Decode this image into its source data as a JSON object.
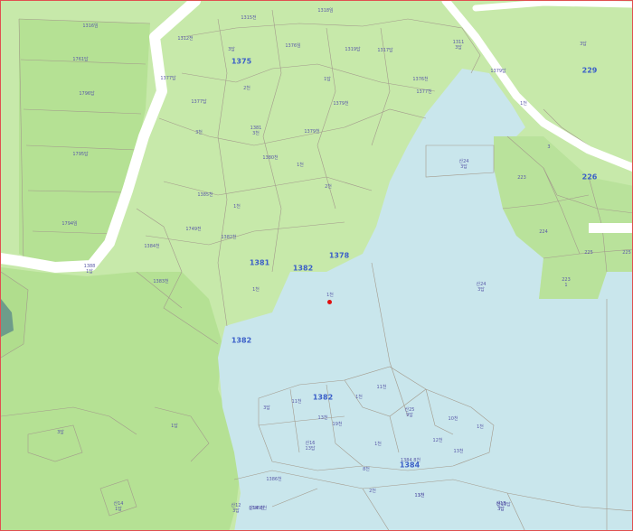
{
  "map": {
    "colors": {
      "forest": "#bfe6a0",
      "forest_light": "#d3efbc",
      "forest_dark": "#a9da84",
      "water": "#c9e6ec",
      "road": "#ffffff",
      "parcel_line": "#a39a8c",
      "block_text": "#3b5fc8",
      "lot_text": "#5a5aa8",
      "marker": "#e01010"
    },
    "block_numbers": [
      {
        "id": "b1375",
        "text": "1375"
      },
      {
        "id": "b229",
        "text": "229"
      },
      {
        "id": "b226",
        "text": "226"
      },
      {
        "id": "b1381",
        "text": "1381"
      },
      {
        "id": "b1382a",
        "text": "1382"
      },
      {
        "id": "b1378",
        "text": "1378"
      },
      {
        "id": "b1382b",
        "text": "1382"
      },
      {
        "id": "b1382c",
        "text": "1382"
      },
      {
        "id": "b1384",
        "text": "1384"
      }
    ],
    "lot_labels": [
      {
        "id": "l01",
        "text": "1316임"
      },
      {
        "id": "l02",
        "text": "1315전"
      },
      {
        "id": "l03",
        "text": "1318임"
      },
      {
        "id": "l04",
        "text": "1312전"
      },
      {
        "id": "l05",
        "text": "3답"
      },
      {
        "id": "l06",
        "text": "1376임"
      },
      {
        "id": "l07",
        "text": "1319답"
      },
      {
        "id": "l08",
        "text": "1317답"
      },
      {
        "id": "l09",
        "text": "1311\n3답"
      },
      {
        "id": "l10",
        "text": "1761답"
      },
      {
        "id": "l11",
        "text": "1377답"
      },
      {
        "id": "l12",
        "text": "3답"
      },
      {
        "id": "l13",
        "text": "1796답"
      },
      {
        "id": "l14",
        "text": "2천"
      },
      {
        "id": "l15",
        "text": "1답"
      },
      {
        "id": "l16",
        "text": "1376천"
      },
      {
        "id": "l17",
        "text": "1377천"
      },
      {
        "id": "l18",
        "text": "1379답"
      },
      {
        "id": "l19",
        "text": "1379천"
      },
      {
        "id": "l20",
        "text": "1377답"
      },
      {
        "id": "l21",
        "text": "1381\n3천"
      },
      {
        "id": "l22",
        "text": "1379천"
      },
      {
        "id": "l23",
        "text": "1795답"
      },
      {
        "id": "l24",
        "text": "1380천"
      },
      {
        "id": "l25",
        "text": "1천"
      },
      {
        "id": "l26",
        "text": "3천"
      },
      {
        "id": "l27",
        "text": "1385천"
      },
      {
        "id": "l28",
        "text": "1794임"
      },
      {
        "id": "l29",
        "text": "1천"
      },
      {
        "id": "l30",
        "text": "1749전"
      },
      {
        "id": "l31",
        "text": "1382천"
      },
      {
        "id": "l32",
        "text": "1384천"
      },
      {
        "id": "l33",
        "text": "1388\n1답"
      },
      {
        "id": "l34",
        "text": "1383천"
      },
      {
        "id": "l35",
        "text": "2천"
      },
      {
        "id": "l36",
        "text": "1천"
      },
      {
        "id": "l37",
        "text": "1천"
      },
      {
        "id": "l38",
        "text": "산24\n3답"
      },
      {
        "id": "l39",
        "text": "1천"
      },
      {
        "id": "l40",
        "text": "223"
      },
      {
        "id": "l41",
        "text": "224"
      },
      {
        "id": "l42",
        "text": "225"
      },
      {
        "id": "l43",
        "text": "223\n1"
      },
      {
        "id": "l44",
        "text": "225"
      },
      {
        "id": "l45",
        "text": "3"
      },
      {
        "id": "l46",
        "text": "산24\n3답"
      },
      {
        "id": "l47",
        "text": "3답"
      },
      {
        "id": "l48",
        "text": "1답"
      },
      {
        "id": "l49",
        "text": "3답"
      },
      {
        "id": "l50",
        "text": "11천"
      },
      {
        "id": "l51",
        "text": "11천"
      },
      {
        "id": "l52",
        "text": "1천"
      },
      {
        "id": "l53",
        "text": "산25\n9답"
      },
      {
        "id": "l54",
        "text": "13천"
      },
      {
        "id": "l55",
        "text": "19천"
      },
      {
        "id": "l56",
        "text": "10천"
      },
      {
        "id": "l57",
        "text": "1천"
      },
      {
        "id": "l58",
        "text": "12천"
      },
      {
        "id": "l59",
        "text": "산16\n13답"
      },
      {
        "id": "l60",
        "text": "1천"
      },
      {
        "id": "l61",
        "text": "13천"
      },
      {
        "id": "l62",
        "text": "산12\n3답"
      },
      {
        "id": "l63",
        "text": "산14\n1답"
      },
      {
        "id": "l64",
        "text": "1386천"
      },
      {
        "id": "l65",
        "text": "8천"
      },
      {
        "id": "l66",
        "text": "1384 8천"
      },
      {
        "id": "l67",
        "text": "13천"
      },
      {
        "id": "l68",
        "text": "2천"
      },
      {
        "id": "l69",
        "text": "산14 8천"
      },
      {
        "id": "l70",
        "text": "산13\n3답"
      },
      {
        "id": "l71",
        "text": "1385천"
      },
      {
        "id": "l72",
        "text": "산13답"
      },
      {
        "id": "l73",
        "text": "산18\n3답"
      },
      {
        "id": "l74",
        "text": "11천"
      }
    ]
  }
}
